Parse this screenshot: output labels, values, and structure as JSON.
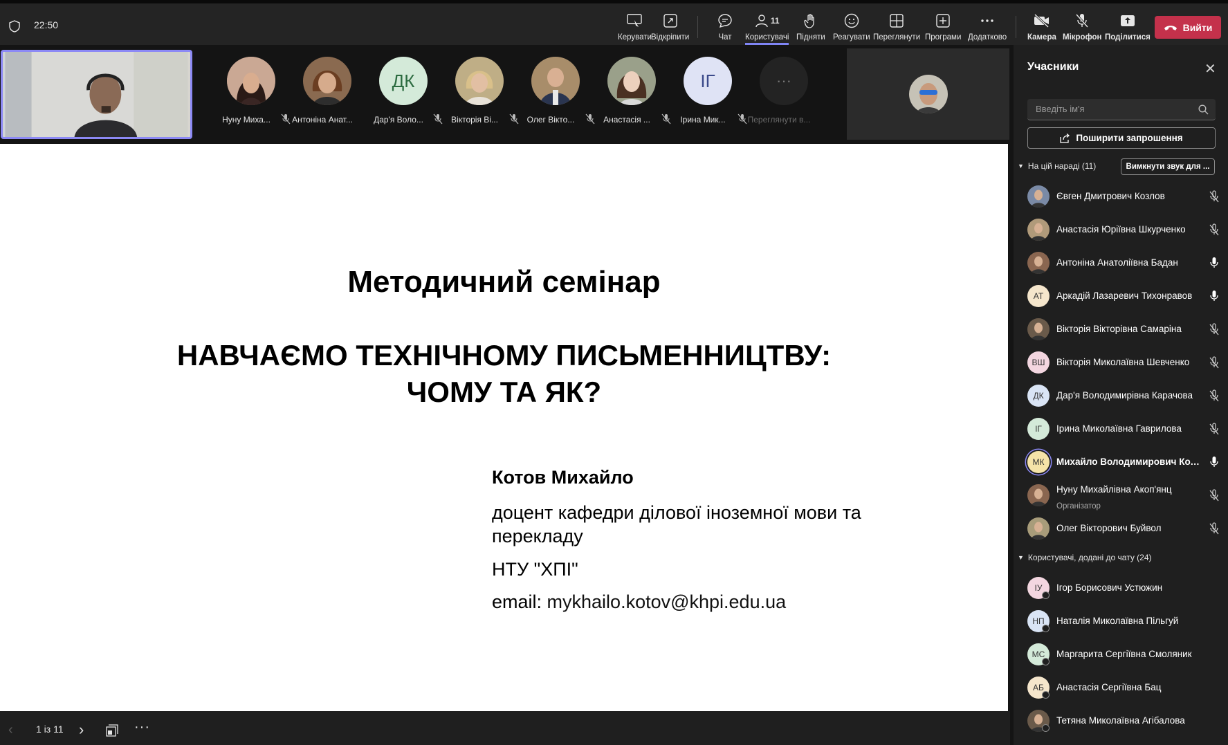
{
  "topbar": {
    "time": "22:50",
    "buttons": {
      "manage": "Керувати",
      "popout": "Відкріпити",
      "chat": "Чат",
      "people": "Користувачі",
      "people_count": "11",
      "raise": "Підняти",
      "react": "Реагувати",
      "view": "Переглянути",
      "apps": "Програми",
      "more": "Додатково",
      "camera": "Камера",
      "mic": "Мікрофон",
      "share": "Поділитися",
      "leave": "Вийти"
    }
  },
  "strip": {
    "tiles": [
      {
        "name": "Нуну Миха...",
        "initials": ""
      },
      {
        "name": "Антоніна Анат...",
        "initials": ""
      },
      {
        "name": "Дар'я Воло...",
        "initials": "ДК"
      },
      {
        "name": "Вікторія Ві...",
        "initials": ""
      },
      {
        "name": "Олег Вікто...",
        "initials": ""
      },
      {
        "name": "Анастасія ...",
        "initials": ""
      },
      {
        "name": "Ірина Мик...",
        "initials": "ІГ"
      },
      {
        "name": "Переглянути в...",
        "initials": "···"
      }
    ]
  },
  "slide": {
    "heading": "Методичний семінар",
    "title_line1": "НАВЧАЄМО ТЕХНІЧНОМУ ПИСЬМЕННИЦТВУ:",
    "title_line2": "ЧОМУ ТА ЯК?",
    "author": "Котов Михайло",
    "position": "доцент кафедри ділової іноземної мови та перекладу",
    "org": "НТУ \"ХПІ\"",
    "email_label": "email: ",
    "email": "mykhailo.kotov@khpi.edu.ua"
  },
  "bottombar": {
    "pages": "1 із 11",
    "more": "···"
  },
  "panel": {
    "title": "Учасники",
    "search_placeholder": "Введіть ім'я",
    "share_invite": "Поширити запрошення",
    "in_meeting_header": "На цій нараді (11)",
    "mute_all": "Вимкнути звук для ...",
    "in_meeting": [
      {
        "name": "Євген Дмитрович Козлов",
        "initials": "",
        "muted": true
      },
      {
        "name": "Анастасія Юріївна Шкурченко",
        "initials": "",
        "muted": true
      },
      {
        "name": "Антоніна Анатоліївна Бадан",
        "initials": "",
        "muted": false
      },
      {
        "name": "Аркадій Лазаревич Тихонравов",
        "initials": "АТ",
        "muted": false
      },
      {
        "name": "Вікторія Вікторівна Самаріна",
        "initials": "",
        "muted": true
      },
      {
        "name": "Вікторія Миколаївна Шевченко",
        "initials": "ВШ",
        "muted": true
      },
      {
        "name": "Дар'я Володимирівна Карачова",
        "initials": "ДК",
        "muted": true
      },
      {
        "name": "Ірина Миколаївна Гаврилова",
        "initials": "ІГ",
        "muted": true
      },
      {
        "name": "Михайло Володимирович Котов",
        "initials": "МК",
        "muted": false
      },
      {
        "name": "Нуну Михайлівна Акоп'янц",
        "initials": "",
        "muted": true,
        "role": "Організатор"
      },
      {
        "name": "Олег Вікторович Буйвол",
        "initials": "",
        "muted": true
      }
    ],
    "chat_header": "Користувачі, додані до чату (24)",
    "chat_users": [
      {
        "name": "Ігор Борисович Устюжин",
        "initials": "ІУ"
      },
      {
        "name": "Наталія Миколаївна Пільгуй",
        "initials": "НП"
      },
      {
        "name": "Маргарита Сергіївна Смоляник",
        "initials": "МС"
      },
      {
        "name": "Анастасія Сергіївна Бац",
        "initials": "АБ"
      },
      {
        "name": "Тетяна Миколаївна Агібалова",
        "initials": ""
      }
    ]
  },
  "colors": {
    "accent": "#7f85f5",
    "leave": "#c4314b",
    "panel_bg": "#1f1f1f",
    "toolbar_bg": "#242424"
  }
}
